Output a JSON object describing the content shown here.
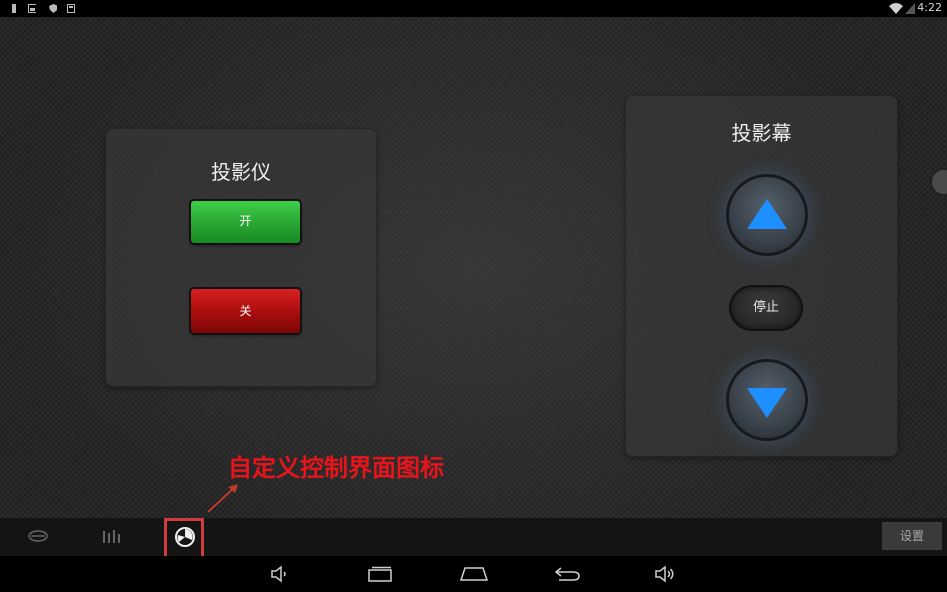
{
  "status_bar": {
    "time": "4:22"
  },
  "projector_panel": {
    "title": "投影仪",
    "on_label": "开",
    "off_label": "关"
  },
  "screen_panel": {
    "title": "投影幕",
    "stop_label": "停止"
  },
  "annotation": {
    "text": "自定义控制界面图标",
    "color": "#e8141c"
  },
  "app_bar": {
    "settings_label": "设置",
    "icons": [
      "lighting-icon",
      "mixer-icon",
      "custom-control-icon"
    ]
  },
  "nav_bar": {
    "icons": [
      "volume-down-icon",
      "recent-apps-icon",
      "home-icon",
      "back-icon",
      "volume-up-icon"
    ]
  },
  "colors": {
    "on_button": "#27a531",
    "off_button": "#a80d0d",
    "arrow_blue": "#1e8fff"
  }
}
